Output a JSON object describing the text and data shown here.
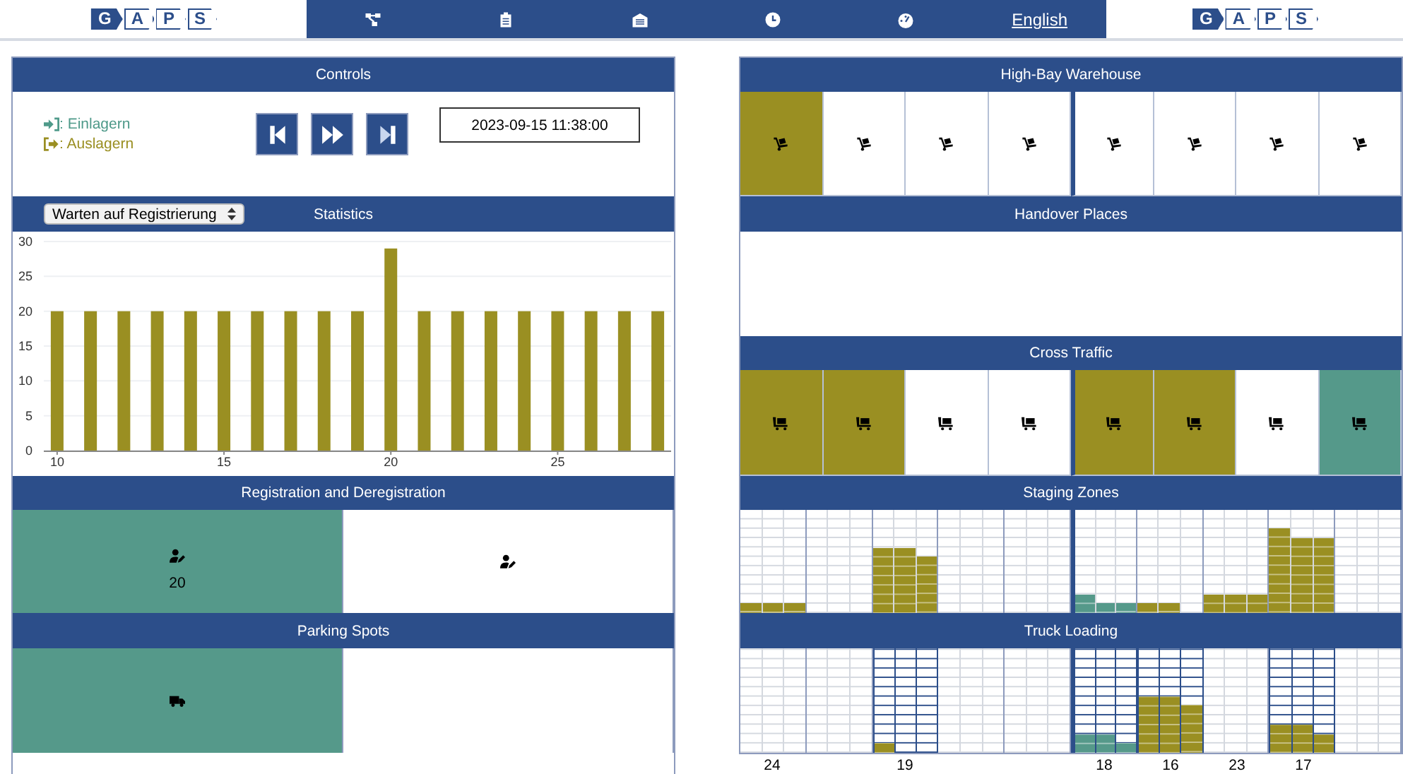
{
  "header": {
    "logo_left": "G A P S",
    "nav": [
      {
        "kind": "network"
      },
      {
        "kind": "clipboard"
      },
      {
        "kind": "warehouse"
      },
      {
        "kind": "clock"
      },
      {
        "kind": "gauge"
      },
      {
        "kind": "link",
        "label": "English"
      }
    ],
    "logo_right": "G A P S"
  },
  "controls": {
    "title": "Controls",
    "legend": [
      {
        "kind": "in",
        "label": ": Einlagern",
        "color": "#4f9a8a"
      },
      {
        "kind": "out",
        "label": ": Auslagern",
        "color": "#9a8f22"
      }
    ],
    "buttons": [
      {
        "kind": "skip-back"
      },
      {
        "kind": "fast-forward"
      },
      {
        "kind": "skip-end"
      }
    ],
    "time": "2023-09-15 11:38:00"
  },
  "statistics": {
    "title": "Statistics",
    "select": "Warten auf Registrierung",
    "chart_data": {
      "type": "bar",
      "x": [
        10,
        11,
        12,
        13,
        14,
        15,
        16,
        17,
        18,
        19,
        20,
        21,
        22,
        23,
        24,
        25,
        26,
        27,
        28
      ],
      "values": [
        20,
        20,
        20,
        20,
        20,
        20,
        20,
        20,
        20,
        20,
        29,
        20,
        20,
        20,
        20,
        20,
        20,
        20,
        20
      ],
      "xlim": [
        9.6,
        28.4
      ],
      "ylim": [
        0,
        30
      ],
      "grid": true,
      "yticks": [
        0,
        5,
        10,
        15,
        20,
        25,
        30
      ],
      "xticks": [
        10,
        15,
        20,
        25
      ]
    }
  },
  "registration": {
    "title": "Registration and Deregistration",
    "cells": [
      {
        "color": "#55998a",
        "count": "20"
      },
      {
        "color": "#ffffff"
      }
    ]
  },
  "parking": {
    "title": "Parking Spots",
    "cells": [
      {
        "color": "#55998a",
        "kind": "truck"
      },
      {
        "color": "#ffffff",
        "kind": "empty"
      }
    ]
  },
  "warehouse": {
    "title": "High-Bay Warehouse",
    "cells": [
      {
        "color": "#9a8f22"
      },
      {
        "color": "#ffffff"
      },
      {
        "color": "#ffffff"
      },
      {
        "color": "#ffffff"
      },
      {
        "color": "#ffffff"
      },
      {
        "color": "#ffffff"
      },
      {
        "color": "#ffffff"
      },
      {
        "color": "#ffffff"
      }
    ]
  },
  "handover": {
    "title": "Handover Places"
  },
  "cross_traffic": {
    "title": "Cross Traffic",
    "cells": [
      {
        "color": "#9a8f22"
      },
      {
        "color": "#9a8f22"
      },
      {
        "color": "#ffffff"
      },
      {
        "color": "#ffffff"
      },
      {
        "color": "#9a8f22"
      },
      {
        "color": "#9a8f22"
      },
      {
        "color": "#ffffff"
      },
      {
        "color": "#55998a"
      }
    ]
  },
  "staging": {
    "title": "Staging Zones",
    "zones": [
      {
        "kind": "filled",
        "color": "#9a8f22",
        "columns": [
          {
            "level": 0.09
          },
          {
            "level": 0.09
          },
          {
            "level": 0.09
          }
        ]
      },
      {
        "kind": "empty"
      },
      {
        "kind": "filled",
        "color": "#9a8f22",
        "columns": [
          {
            "level": 0.64
          },
          {
            "level": 0.64
          },
          {
            "level": 0.55
          }
        ]
      },
      {
        "kind": "empty"
      },
      {
        "kind": "empty"
      },
      {
        "kind": "filled",
        "color": "#55998a",
        "columns": [
          {
            "level": 0.18
          },
          {
            "level": 0.09
          },
          {
            "level": 0.09
          }
        ]
      },
      {
        "kind": "filled",
        "color": "#9a8f22",
        "columns": [
          {
            "level": 0.09
          },
          {
            "level": 0.09
          }
        ]
      },
      {
        "kind": "filled",
        "color": "#9a8f22",
        "columns": [
          {
            "level": 0.18
          },
          {
            "level": 0.18
          },
          {
            "level": 0.18
          }
        ]
      },
      {
        "kind": "filled",
        "color": "#9a8f22",
        "columns": [
          {
            "level": 0.82
          },
          {
            "level": 0.73
          },
          {
            "level": 0.73
          }
        ]
      },
      {
        "kind": "empty"
      }
    ]
  },
  "truck_loading": {
    "title": "Truck Loading",
    "zones": [
      {
        "active": false,
        "label": "24"
      },
      {
        "active": false
      },
      {
        "active": true,
        "label": "19",
        "color": "#9a8f22",
        "columns": [
          {
            "level": 0.09
          }
        ]
      },
      {
        "active": false
      },
      {
        "active": false
      },
      {
        "active": true,
        "label": "18",
        "color": "#55998a",
        "columns": [
          {
            "level": 0.18
          },
          {
            "level": 0.18
          },
          {
            "level": 0.09
          }
        ]
      },
      {
        "active": true,
        "label": "16",
        "color": "#9a8f22",
        "columns": [
          {
            "level": 0.55
          },
          {
            "level": 0.55
          },
          {
            "level": 0.45
          }
        ]
      },
      {
        "active": false,
        "label": "23"
      },
      {
        "active": true,
        "label": "17",
        "color": "#9a8f22",
        "columns": [
          {
            "level": 0.27
          },
          {
            "level": 0.27
          },
          {
            "level": 0.18
          }
        ]
      },
      {
        "active": false
      }
    ]
  }
}
